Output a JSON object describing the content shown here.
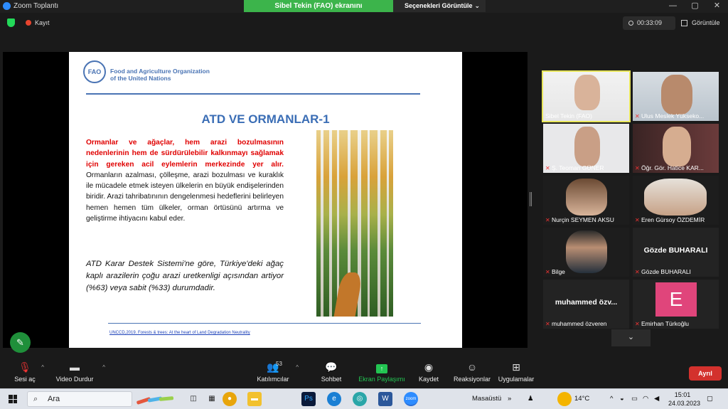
{
  "window": {
    "title": "Zoom Toplantı",
    "controls": [
      "—",
      "▢",
      "✕"
    ]
  },
  "banner": {
    "share_text": "Sibel Tekin (FAO) ekranını görüntülüyorsunuz",
    "options_label": "Seçenekleri Görüntüle",
    "options_chevron": "⌄"
  },
  "topbar": {
    "record_label": "Kayıt",
    "timer": "00:33:09",
    "view_label": "Görüntüle"
  },
  "slide": {
    "org_line1": "Food and Agriculture Organization",
    "org_line2": "of the United Nations",
    "logo_text": "FAO",
    "title": "ATD VE ORMANLAR-1",
    "para1_red": "Ormanlar ve ağaçlar, hem arazi bozulmasının nedenlerinin hem de sürdürülebilir kalkınmayı sağlamak için gereken acil eylemlerin merkezinde yer alır.",
    "para1_rest": " Ormanların azalması, çölleşme, arazi bozulması ve kuraklık ile mücadele etmek isteyen ülkelerin en büyük endişelerinden biridir. Arazi tahribatınının dengelenmesi hedeflerini belirleyen hemen hemen tüm ülkeler, orman örtüsünü artırma ve geliştirme ihtiyacını kabul eder.",
    "para2": "ATD Karar Destek Sistemi'ne göre, Türkiye'deki ağaç kaplı arazilerin çoğu arazi uretkenligi açısından artiyor (%63) veya sabit (%33) durumdadir.",
    "citation": "UNCCD,2019. Forests & trees: At the heart of Land Degradation Neutrality"
  },
  "participants": [
    {
      "name": "Sibel Tekin (FAO)",
      "muted": false,
      "active": true
    },
    {
      "name": "Ulus Meslek Yükseko...",
      "muted": true
    },
    {
      "name": "Ş. Teoman GÜNER",
      "muted": true
    },
    {
      "name": "Öğr. Gör. Hatice KAR...",
      "muted": true
    },
    {
      "name": "Nurçin SEYMEN AKSU",
      "muted": true
    },
    {
      "name": "Eren Gürsoy ÖZDEMİR",
      "muted": true
    },
    {
      "name": "Bilge",
      "muted": true
    },
    {
      "name": "Gözde BUHARALI",
      "muted": true,
      "big_name": "Gözde BUHARALI"
    },
    {
      "name": "muhammed özveren",
      "muted": true,
      "big_name": "muhammed özv..."
    },
    {
      "name": "Emirhan Türkoğlu",
      "muted": true,
      "avatar_letter": "E"
    }
  ],
  "toolbar": {
    "mic_label": "Sesi aç",
    "video_label": "Video Durdur",
    "participants_label": "Katılımcılar",
    "participants_count": "53",
    "chat_label": "Sohbet",
    "share_label": "Ekran Paylaşımı",
    "record_label": "Kaydet",
    "reactions_label": "Reaksiyonlar",
    "apps_label": "Uygulamalar",
    "leave_label": "Ayrıl"
  },
  "taskbar": {
    "search_placeholder": "Ara",
    "desktop_label": "Masaüstü",
    "temperature": "14°C",
    "time": "15:01",
    "date": "24.03.2023"
  },
  "colors": {
    "share_green": "#3cb44b",
    "leave_red": "#d3312d",
    "fao_blue": "#4a74b4",
    "slide_red": "#e00000",
    "active_speaker": "#e7e55a"
  }
}
